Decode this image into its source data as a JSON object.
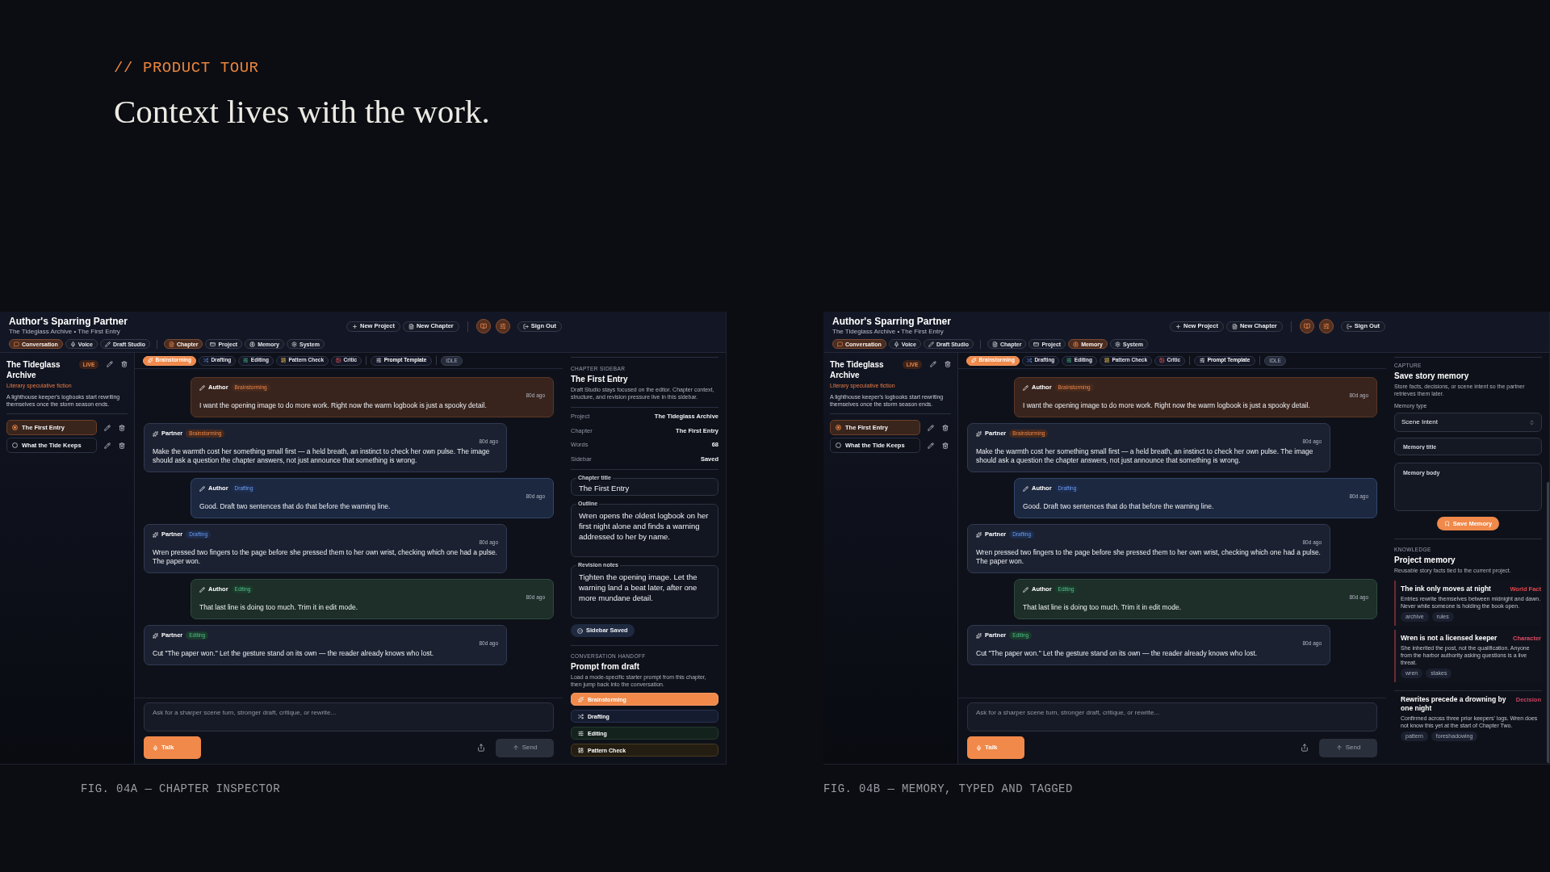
{
  "eyebrow": "// PRODUCT TOUR",
  "headline": "Context lives with the work.",
  "figures": [
    {
      "caption": "FIG. 04A — CHAPTER INSPECTOR",
      "app": {
        "title": "Author's Sparring Partner",
        "subtitle": "The Tideglass Archive • The First Entry",
        "nav_groups": [
          {
            "items": [
              {
                "label": "Conversation",
                "selected": true
              },
              {
                "label": "Voice",
                "selected": false
              },
              {
                "label": "Draft Studio",
                "selected": false
              }
            ]
          },
          {
            "items": [
              {
                "label": "Chapter",
                "selected": true
              },
              {
                "label": "Project",
                "selected": false
              },
              {
                "label": "Memory",
                "selected": false
              },
              {
                "label": "System",
                "selected": false
              }
            ]
          }
        ],
        "actions": [
          "New Project",
          "New Chapter"
        ],
        "sign_out": "Sign Out",
        "sidebar": {
          "project": {
            "title": "The Tideglass Archive",
            "status": "LIVE",
            "genre": "Literary speculative fiction",
            "description": "A lighthouse keeper's logbooks start rewriting themselves once the storm season ends."
          },
          "chapters": [
            {
              "title": "The First Entry",
              "selected": true
            },
            {
              "title": "What the Tide Keeps",
              "selected": false
            }
          ]
        },
        "chat": {
          "modes": [
            {
              "label": "Brainstorming",
              "kind": "brainstorming",
              "selected": true
            },
            {
              "label": "Drafting",
              "kind": "drafting",
              "selected": false
            },
            {
              "label": "Editing",
              "kind": "editing",
              "selected": false
            },
            {
              "label": "Pattern Check",
              "kind": "pattern",
              "selected": false
            },
            {
              "label": "Critic",
              "kind": "critic",
              "selected": false
            }
          ],
          "template_button": "Prompt Template",
          "status": "IDLE",
          "messages": [
            {
              "kind": "author",
              "sender": "Author",
              "mode": {
                "label": "Brainstorming",
                "kind": "brainstorming"
              },
              "time": "80d ago",
              "text": "I want the opening image to do more work. Right now the warm logbook is just a spooky detail."
            },
            {
              "kind": "partner",
              "sender": "Partner",
              "mode": {
                "label": "Brainstorming",
                "kind": "brainstorming"
              },
              "time": "80d ago",
              "text": "Make the warmth cost her something small first — a held breath, an instinct to check her own pulse. The image should ask a question the chapter answers, not just announce that something is wrong."
            },
            {
              "kind": "author",
              "sender": "Author",
              "mode": {
                "label": "Drafting",
                "kind": "drafting"
              },
              "time": "80d ago",
              "text": "Good. Draft two sentences that do that before the warning line."
            },
            {
              "kind": "partner",
              "sender": "Partner",
              "mode": {
                "label": "Drafting",
                "kind": "drafting"
              },
              "time": "80d ago",
              "text": "Wren pressed two fingers to the page before she pressed them to her own wrist, checking which one had a pulse. The paper won."
            },
            {
              "kind": "author",
              "sender": "Author",
              "mode": {
                "label": "Editing",
                "kind": "editing"
              },
              "time": "80d ago",
              "text": "That last line is doing too much. Trim it in edit mode."
            },
            {
              "kind": "partner",
              "sender": "Partner",
              "mode": {
                "label": "Editing",
                "kind": "editing"
              },
              "time": "80d ago",
              "text": "Cut \"The paper won.\" Let the gesture stand on its own — the reader already knows who lost."
            }
          ],
          "input": {
            "placeholder": "Ask for a sharper scene turn, stronger draft, critique, or rewrite..."
          },
          "talk_button": "Talk",
          "send_button": {
            "label": "Send",
            "disabled": true
          }
        },
        "side_panel": {
          "kind": "chapter",
          "eyebrow": "CHAPTER SIDEBAR",
          "title": "The First Entry",
          "description": "Draft Studio stays focused on the editor. Chapter context, structure, and revision pressure live in this sidebar.",
          "facts": [
            {
              "label": "Project",
              "value": "The Tideglass Archive"
            },
            {
              "label": "Chapter",
              "value": "The First Entry"
            },
            {
              "label": "Words",
              "value": "68"
            },
            {
              "label": "Sidebar",
              "value": "Saved"
            }
          ],
          "fields": [
            {
              "label": "Chapter title",
              "value": "The First Entry",
              "kind": "line"
            },
            {
              "label": "Outline",
              "value": "Wren opens the oldest logbook on her first night alone and finds a warning addressed to her by name.",
              "kind": "area"
            },
            {
              "label": "Revision notes",
              "value": "Tighten the opening image. Let the warning land a beat later, after one more mundane detail.",
              "kind": "area"
            }
          ],
          "save_button": "Sidebar Saved",
          "handoff": {
            "eyebrow": "CONVERSATION HANDOFF",
            "title": "Prompt from draft",
            "description": "Load a mode-specific starter prompt from this chapter, then jump back into the conversation.",
            "modes": [
              {
                "label": "Brainstorming",
                "kind": "brainstorming",
                "selected": true
              },
              {
                "label": "Drafting",
                "kind": "drafting",
                "selected": false
              },
              {
                "label": "Editing",
                "kind": "editing",
                "selected": false
              },
              {
                "label": "Pattern Check",
                "kind": "pattern",
                "selected": false
              }
            ]
          }
        }
      }
    },
    {
      "caption": "FIG. 04B — MEMORY, TYPED AND TAGGED",
      "app": {
        "title": "Author's Sparring Partner",
        "subtitle": "The Tideglass Archive • The First Entry",
        "nav_groups": [
          {
            "items": [
              {
                "label": "Conversation",
                "selected": true
              },
              {
                "label": "Voice",
                "selected": false
              },
              {
                "label": "Draft Studio",
                "selected": false
              }
            ]
          },
          {
            "items": [
              {
                "label": "Chapter",
                "selected": false
              },
              {
                "label": "Project",
                "selected": false
              },
              {
                "label": "Memory",
                "selected": true
              },
              {
                "label": "System",
                "selected": false
              }
            ]
          }
        ],
        "actions": [
          "New Project",
          "New Chapter"
        ],
        "sign_out": "Sign Out",
        "sidebar": {
          "project": {
            "title": "The Tideglass Archive",
            "status": "LIVE",
            "genre": "Literary speculative fiction",
            "description": "A lighthouse keeper's logbooks start rewriting themselves once the storm season ends."
          },
          "chapters": [
            {
              "title": "The First Entry",
              "selected": true
            },
            {
              "title": "What the Tide Keeps",
              "selected": false
            }
          ]
        },
        "chat": {
          "modes": [
            {
              "label": "Brainstorming",
              "kind": "brainstorming",
              "selected": true
            },
            {
              "label": "Drafting",
              "kind": "drafting",
              "selected": false
            },
            {
              "label": "Editing",
              "kind": "editing",
              "selected": false
            },
            {
              "label": "Pattern Check",
              "kind": "pattern",
              "selected": false
            },
            {
              "label": "Critic",
              "kind": "critic",
              "selected": false
            }
          ],
          "template_button": "Prompt Template",
          "status": "IDLE",
          "messages": [
            {
              "kind": "author",
              "sender": "Author",
              "mode": {
                "label": "Brainstorming",
                "kind": "brainstorming"
              },
              "time": "80d ago",
              "text": "I want the opening image to do more work. Right now the warm logbook is just a spooky detail."
            },
            {
              "kind": "partner",
              "sender": "Partner",
              "mode": {
                "label": "Brainstorming",
                "kind": "brainstorming"
              },
              "time": "80d ago",
              "text": "Make the warmth cost her something small first — a held breath, an instinct to check her own pulse. The image should ask a question the chapter answers, not just announce that something is wrong."
            },
            {
              "kind": "author",
              "sender": "Author",
              "mode": {
                "label": "Drafting",
                "kind": "drafting"
              },
              "time": "80d ago",
              "text": "Good. Draft two sentences that do that before the warning line."
            },
            {
              "kind": "partner",
              "sender": "Partner",
              "mode": {
                "label": "Drafting",
                "kind": "drafting"
              },
              "time": "80d ago",
              "text": "Wren pressed two fingers to the page before she pressed them to her own wrist, checking which one had a pulse. The paper won."
            },
            {
              "kind": "author",
              "sender": "Author",
              "mode": {
                "label": "Editing",
                "kind": "editing"
              },
              "time": "80d ago",
              "text": "That last line is doing too much. Trim it in edit mode."
            },
            {
              "kind": "partner",
              "sender": "Partner",
              "mode": {
                "label": "Editing",
                "kind": "editing"
              },
              "time": "80d ago",
              "text": "Cut \"The paper won.\" Let the gesture stand on its own — the reader already knows who lost."
            }
          ],
          "input": {
            "placeholder": "Ask for a sharper scene turn, stronger draft, critique, or rewrite..."
          },
          "talk_button": "Talk",
          "send_button": {
            "label": "Send",
            "disabled": true
          }
        },
        "side_panel": {
          "kind": "memory",
          "capture": {
            "eyebrow": "CAPTURE",
            "title": "Save story memory",
            "description": "Store facts, decisions, or scene intent so the partner retrieves them later.",
            "type_label": "Memory type",
            "type_value": "Scene Intent",
            "title_field": {
              "placeholder": "Memory title"
            },
            "body_field": {
              "placeholder": "Memory body"
            },
            "save_button": "Save Memory"
          },
          "knowledge": {
            "eyebrow": "KNOWLEDGE",
            "title": "Project memory",
            "description": "Reusable story facts tied to the current project.",
            "items": [
              {
                "title": "The ink only moves at night",
                "type": "World Fact",
                "color": "#e0474f",
                "marked": true,
                "body": "Entries rewrite themselves between midnight and dawn. Never while someone is holding the book open.",
                "tags": [
                  "archive",
                  "rules"
                ]
              },
              {
                "title": "Wren is not a licensed keeper",
                "type": "Character",
                "color": "#e04a63",
                "marked": true,
                "body": "She inherited the post, not the qualification. Anyone from the harbor authority asking questions is a live threat.",
                "tags": [
                  "wren",
                  "stakes"
                ]
              },
              {
                "title": "Rewrites precede a drowning by one night",
                "type": "Decision",
                "color": "#c94462",
                "marked": false,
                "body": "Confirmed across three prior keepers' logs. Wren does not know this yet at the start of Chapter Two.",
                "tags": [
                  "pattern",
                  "foreshadowing"
                ]
              }
            ]
          }
        }
      }
    }
  ]
}
